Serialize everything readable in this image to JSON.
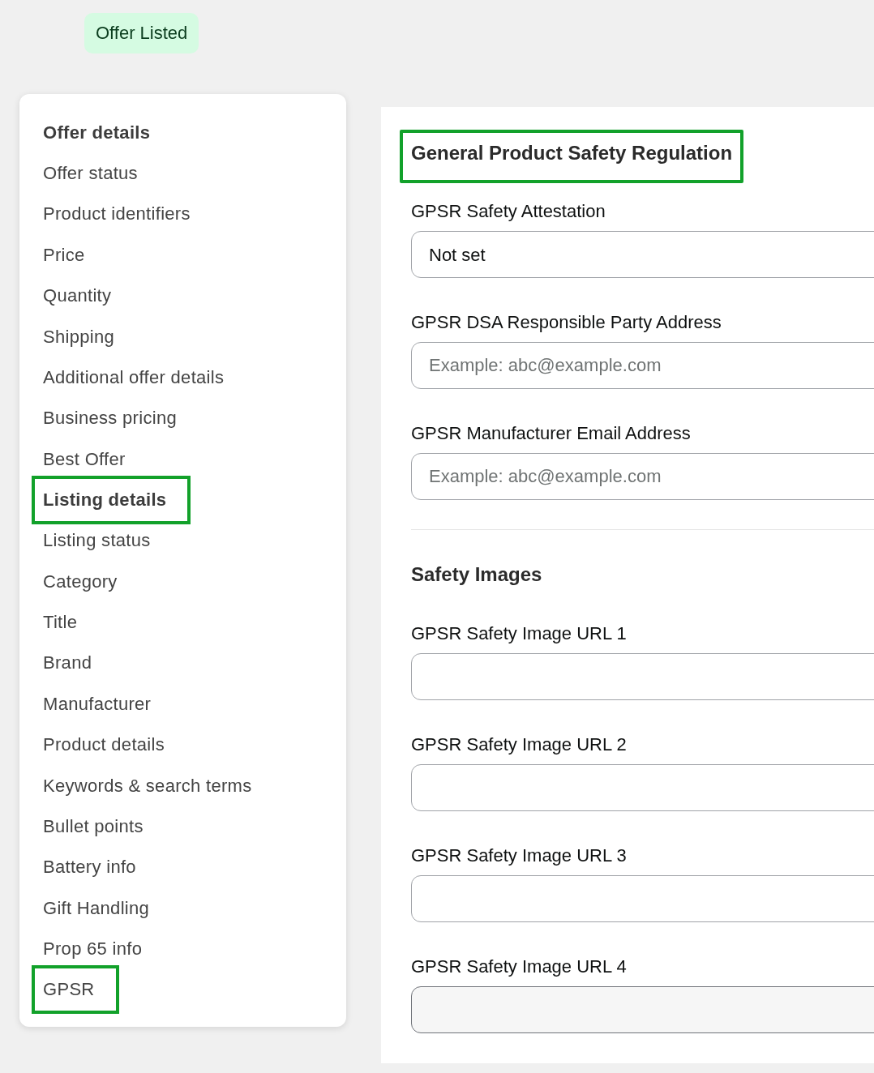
{
  "status_badge": "Offer Listed",
  "sidebar": {
    "items": [
      {
        "kind": "heading",
        "label": "Offer details",
        "highlighted": false
      },
      {
        "kind": "link",
        "label": "Offer status",
        "highlighted": false
      },
      {
        "kind": "link",
        "label": "Product identifiers",
        "highlighted": false
      },
      {
        "kind": "link",
        "label": "Price",
        "highlighted": false
      },
      {
        "kind": "link",
        "label": "Quantity",
        "highlighted": false
      },
      {
        "kind": "link",
        "label": "Shipping",
        "highlighted": false
      },
      {
        "kind": "link",
        "label": "Additional offer details",
        "highlighted": false
      },
      {
        "kind": "link",
        "label": "Business pricing",
        "highlighted": false
      },
      {
        "kind": "link",
        "label": "Best Offer",
        "highlighted": false
      },
      {
        "kind": "heading",
        "label": "Listing details",
        "highlighted": true
      },
      {
        "kind": "link",
        "label": "Listing status",
        "highlighted": false
      },
      {
        "kind": "link",
        "label": "Category",
        "highlighted": false
      },
      {
        "kind": "link",
        "label": "Title",
        "highlighted": false
      },
      {
        "kind": "link",
        "label": "Brand",
        "highlighted": false
      },
      {
        "kind": "link",
        "label": "Manufacturer",
        "highlighted": false
      },
      {
        "kind": "link",
        "label": "Product details",
        "highlighted": false
      },
      {
        "kind": "link",
        "label": "Keywords & search terms",
        "highlighted": false
      },
      {
        "kind": "link",
        "label": "Bullet points",
        "highlighted": false
      },
      {
        "kind": "link",
        "label": "Battery info",
        "highlighted": false
      },
      {
        "kind": "link",
        "label": "Gift Handling",
        "highlighted": false
      },
      {
        "kind": "link",
        "label": "Prop 65 info",
        "highlighted": false
      },
      {
        "kind": "link",
        "label": "GPSR",
        "highlighted": true
      }
    ]
  },
  "panel": {
    "title": "General Product Safety Regulation",
    "title_highlighted": true,
    "fields": [
      {
        "kind": "select",
        "label": "GPSR Safety Attestation",
        "value": "Not set",
        "disabled": false
      },
      {
        "kind": "text",
        "label": "GPSR DSA Responsible Party Address",
        "placeholder": "Example: abc@example.com",
        "disabled": false
      },
      {
        "kind": "text",
        "label": "GPSR Manufacturer Email Address",
        "placeholder": "Example: abc@example.com",
        "disabled": false
      }
    ],
    "section_title": "Safety Images",
    "image_fields": [
      {
        "kind": "text",
        "label": "GPSR Safety Image URL 1",
        "disabled": false
      },
      {
        "kind": "text",
        "label": "GPSR Safety Image URL 2",
        "disabled": false
      },
      {
        "kind": "text",
        "label": "GPSR Safety Image URL 3",
        "disabled": false
      },
      {
        "kind": "text",
        "label": "GPSR Safety Image URL 4",
        "disabled": true
      }
    ]
  }
}
